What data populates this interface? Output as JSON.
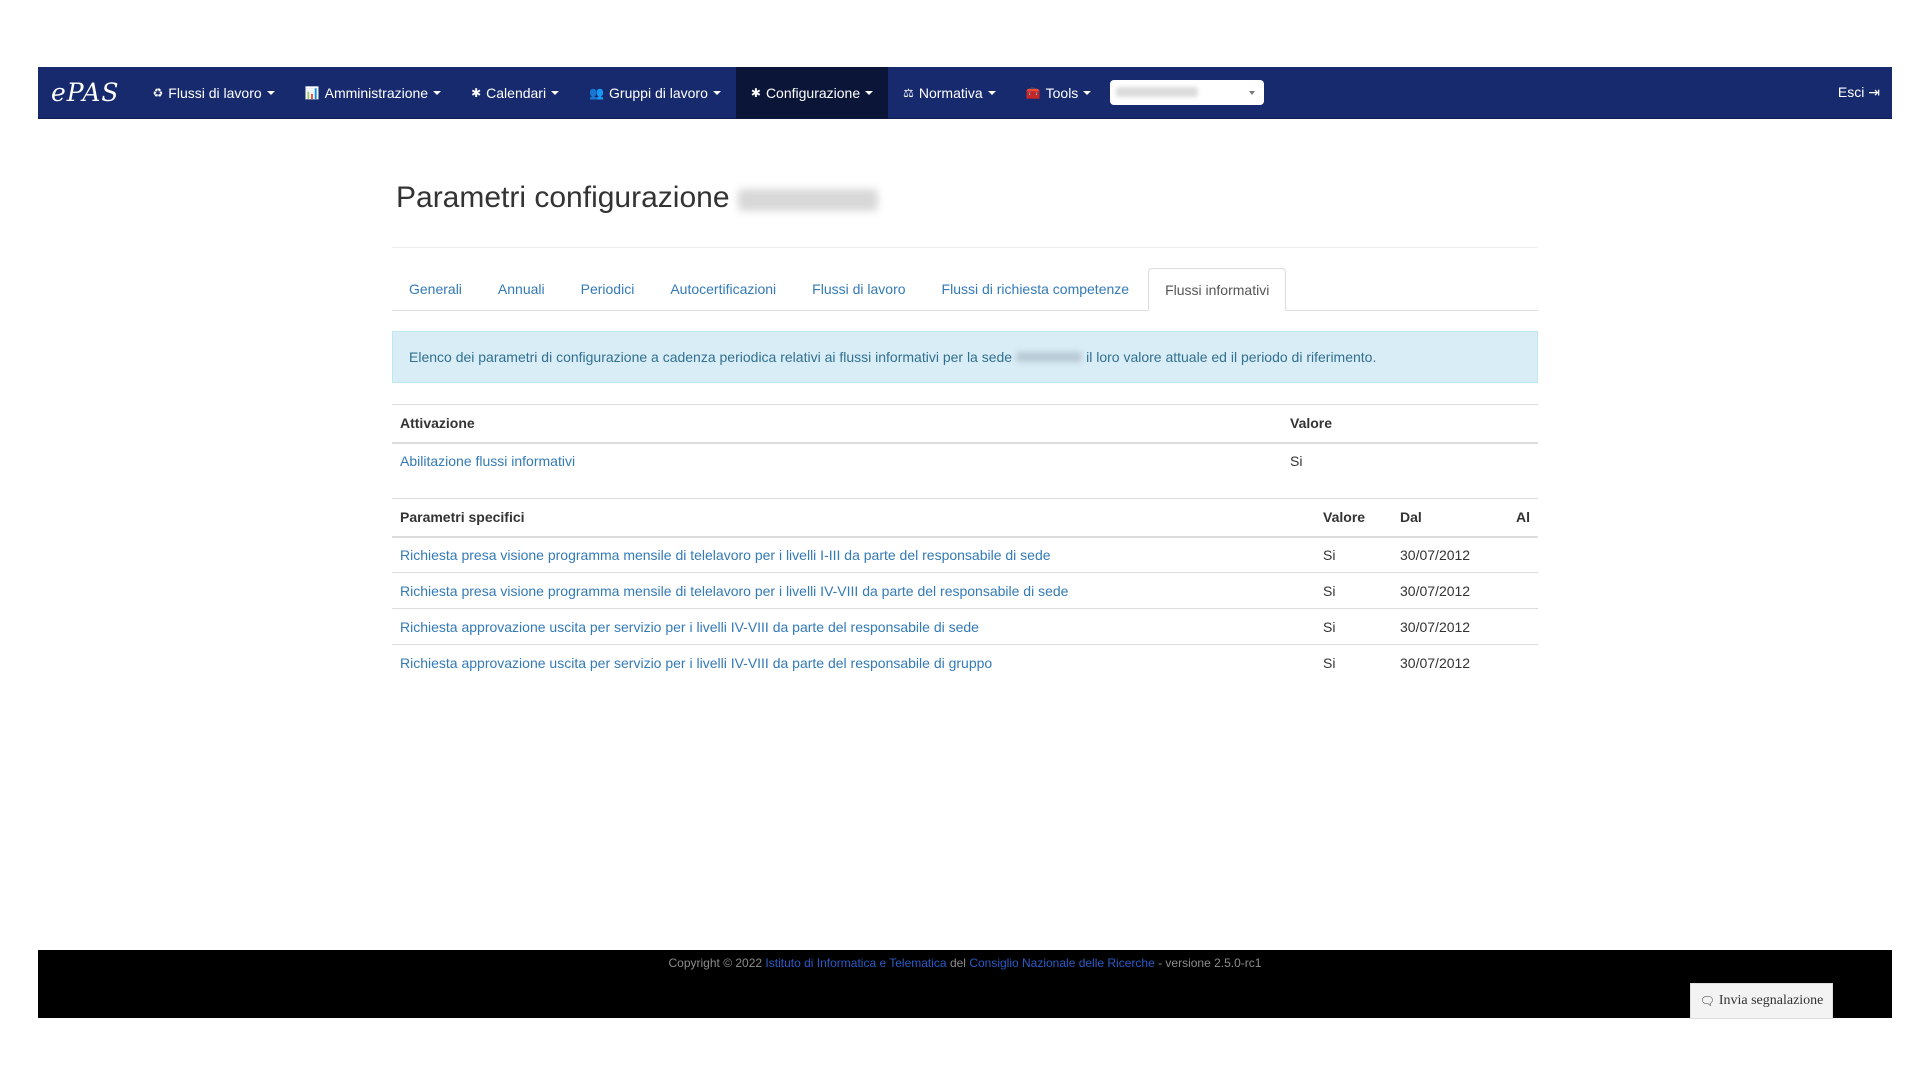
{
  "navbar": {
    "brand": "ePAS",
    "items": [
      {
        "label": "Flussi di lavoro",
        "icon": "♻",
        "icon_name": "recycle-icon"
      },
      {
        "label": "Amministrazione",
        "icon": "📊",
        "icon_name": "bar-chart-icon"
      },
      {
        "label": "Calendari",
        "icon": "✱",
        "icon_name": "gear-icon"
      },
      {
        "label": "Gruppi di lavoro",
        "icon": "👥",
        "icon_name": "users-icon"
      },
      {
        "label": "Configurazione",
        "icon": "✱",
        "icon_name": "gear-icon"
      },
      {
        "label": "Normativa",
        "icon": "⚖",
        "icon_name": "balance-scale-icon"
      },
      {
        "label": "Tools",
        "icon": "🧰",
        "icon_name": "toolbox-icon"
      }
    ],
    "active_item": "Configurazione",
    "logout_label": "Esci",
    "logout_icon": "⇥"
  },
  "page": {
    "title": "Parametri configurazione"
  },
  "tabs": [
    "Generali",
    "Annuali",
    "Periodici",
    "Autocertificazioni",
    "Flussi di lavoro",
    "Flussi di richiesta competenze",
    "Flussi informativi"
  ],
  "active_tab": "Flussi informativi",
  "alert": {
    "text_before": "Elenco dei parametri di configurazione a cadenza periodica relativi ai flussi informativi per la sede",
    "text_after": "il loro valore attuale ed il periodo di riferimento."
  },
  "attivazione_table": {
    "headers": [
      "Attivazione",
      "Valore"
    ],
    "rows": [
      {
        "name": "Abilitazione flussi informativi",
        "value": "Si"
      }
    ]
  },
  "parametri_table": {
    "headers": [
      "Parametri specifici",
      "Valore",
      "Dal",
      "Al"
    ],
    "rows": [
      {
        "name": "Richiesta presa visione programma mensile di telelavoro per i livelli I-III da parte del responsabile di sede",
        "value": "Si",
        "dal": "30/07/2012",
        "al": ""
      },
      {
        "name": "Richiesta presa visione programma mensile di telelavoro per i livelli IV-VIII da parte del responsabile di sede",
        "value": "Si",
        "dal": "30/07/2012",
        "al": ""
      },
      {
        "name": "Richiesta approvazione uscita per servizio per i livelli IV-VIII da parte del responsabile di sede",
        "value": "Si",
        "dal": "30/07/2012",
        "al": ""
      },
      {
        "name": "Richiesta approvazione uscita per servizio per i livelli IV-VIII da parte del responsabile di gruppo",
        "value": "Si",
        "dal": "30/07/2012",
        "al": ""
      }
    ]
  },
  "footer": {
    "prefix": "Copyright © 2022",
    "link1": "Istituto di Informatica e Telematica",
    "middle": "del",
    "link2": "Consiglio Nazionale delle Ricerche",
    "suffix": "- versione 2.5.0-rc1"
  },
  "report_button": {
    "label": "Invia segnalazione",
    "icon": "🗨"
  },
  "colors": {
    "navbar_bg": "#172a6e",
    "navbar_active_bg": "#0b1538",
    "link": "#337ab7",
    "alert_bg": "#d9edf7",
    "alert_text": "#31708f",
    "footer_bg": "#000000"
  }
}
